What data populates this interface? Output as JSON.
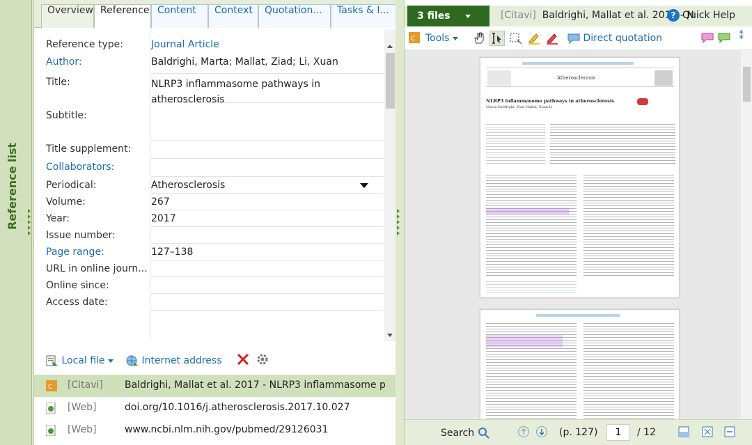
{
  "sidebar": {
    "title": "Reference list"
  },
  "tabs": [
    {
      "label": "Overview"
    },
    {
      "label": "Reference"
    },
    {
      "label": "Content"
    },
    {
      "label": "Context"
    },
    {
      "label": "Quotation..."
    },
    {
      "label": "Tasks & I..."
    }
  ],
  "fields": [
    {
      "key": "Reference type:",
      "value": "Journal Article"
    },
    {
      "key": "Author:",
      "value": "Baldrighi, Marta; Mallat, Ziad; Li, Xuan"
    },
    {
      "key": "Title:",
      "value": "NLRP3 inflammasome pathways in",
      "value2": "atherosclerosis"
    },
    {
      "key": "Subtitle:",
      "value": ""
    },
    {
      "key": "Title supplement:",
      "value": ""
    },
    {
      "key": "Collaborators:",
      "value": ""
    },
    {
      "key": "Periodical:",
      "value": "Atherosclerosis"
    },
    {
      "key": "Volume:",
      "value": "267"
    },
    {
      "key": "Year:",
      "value": "2017"
    },
    {
      "key": "Issue number:",
      "value": ""
    },
    {
      "key": "Page range:",
      "value": "127–138"
    },
    {
      "key": "URL in online journ...",
      "value": ""
    },
    {
      "key": "Online since:",
      "value": ""
    },
    {
      "key": "Access date:",
      "value": ""
    }
  ],
  "locations_toolbar": {
    "local_file": "Local file",
    "internet_address": "Internet address"
  },
  "locations": [
    {
      "tag": "[Citavi]",
      "name": "Baldrighi, Mallat et al. 2017 - NLRP3 inflammasome p"
    },
    {
      "tag": "[Web]",
      "name": "doi.org/10.1016/j.atherosclerosis.2017.10.027"
    },
    {
      "tag": "[Web]",
      "name": "www.ncbi.nlm.nih.gov/pubmed/29126031"
    }
  ],
  "viewer": {
    "files_button": "3 files",
    "title_tag": "[Citavi]",
    "title": "Baldrighi, Mallat et al. 2017 - N",
    "help": "Quick Help",
    "tools": "Tools",
    "direct_quotation": "Direct quotation",
    "search": "Search",
    "page_label": "(p. 127)",
    "page_number": "1",
    "page_total": "/ 12"
  },
  "doc_page": {
    "journal": "Atherosclerosis",
    "heading": "NLRP3 inflammasome pathways in atherosclerosis",
    "authors": "Marta Baldrighi, Ziad Mallat, Xuan Li"
  },
  "colors": {
    "accent": "#1a6cb6",
    "brand": "#2d6a1f",
    "sidebar": "#d2e0bd"
  }
}
